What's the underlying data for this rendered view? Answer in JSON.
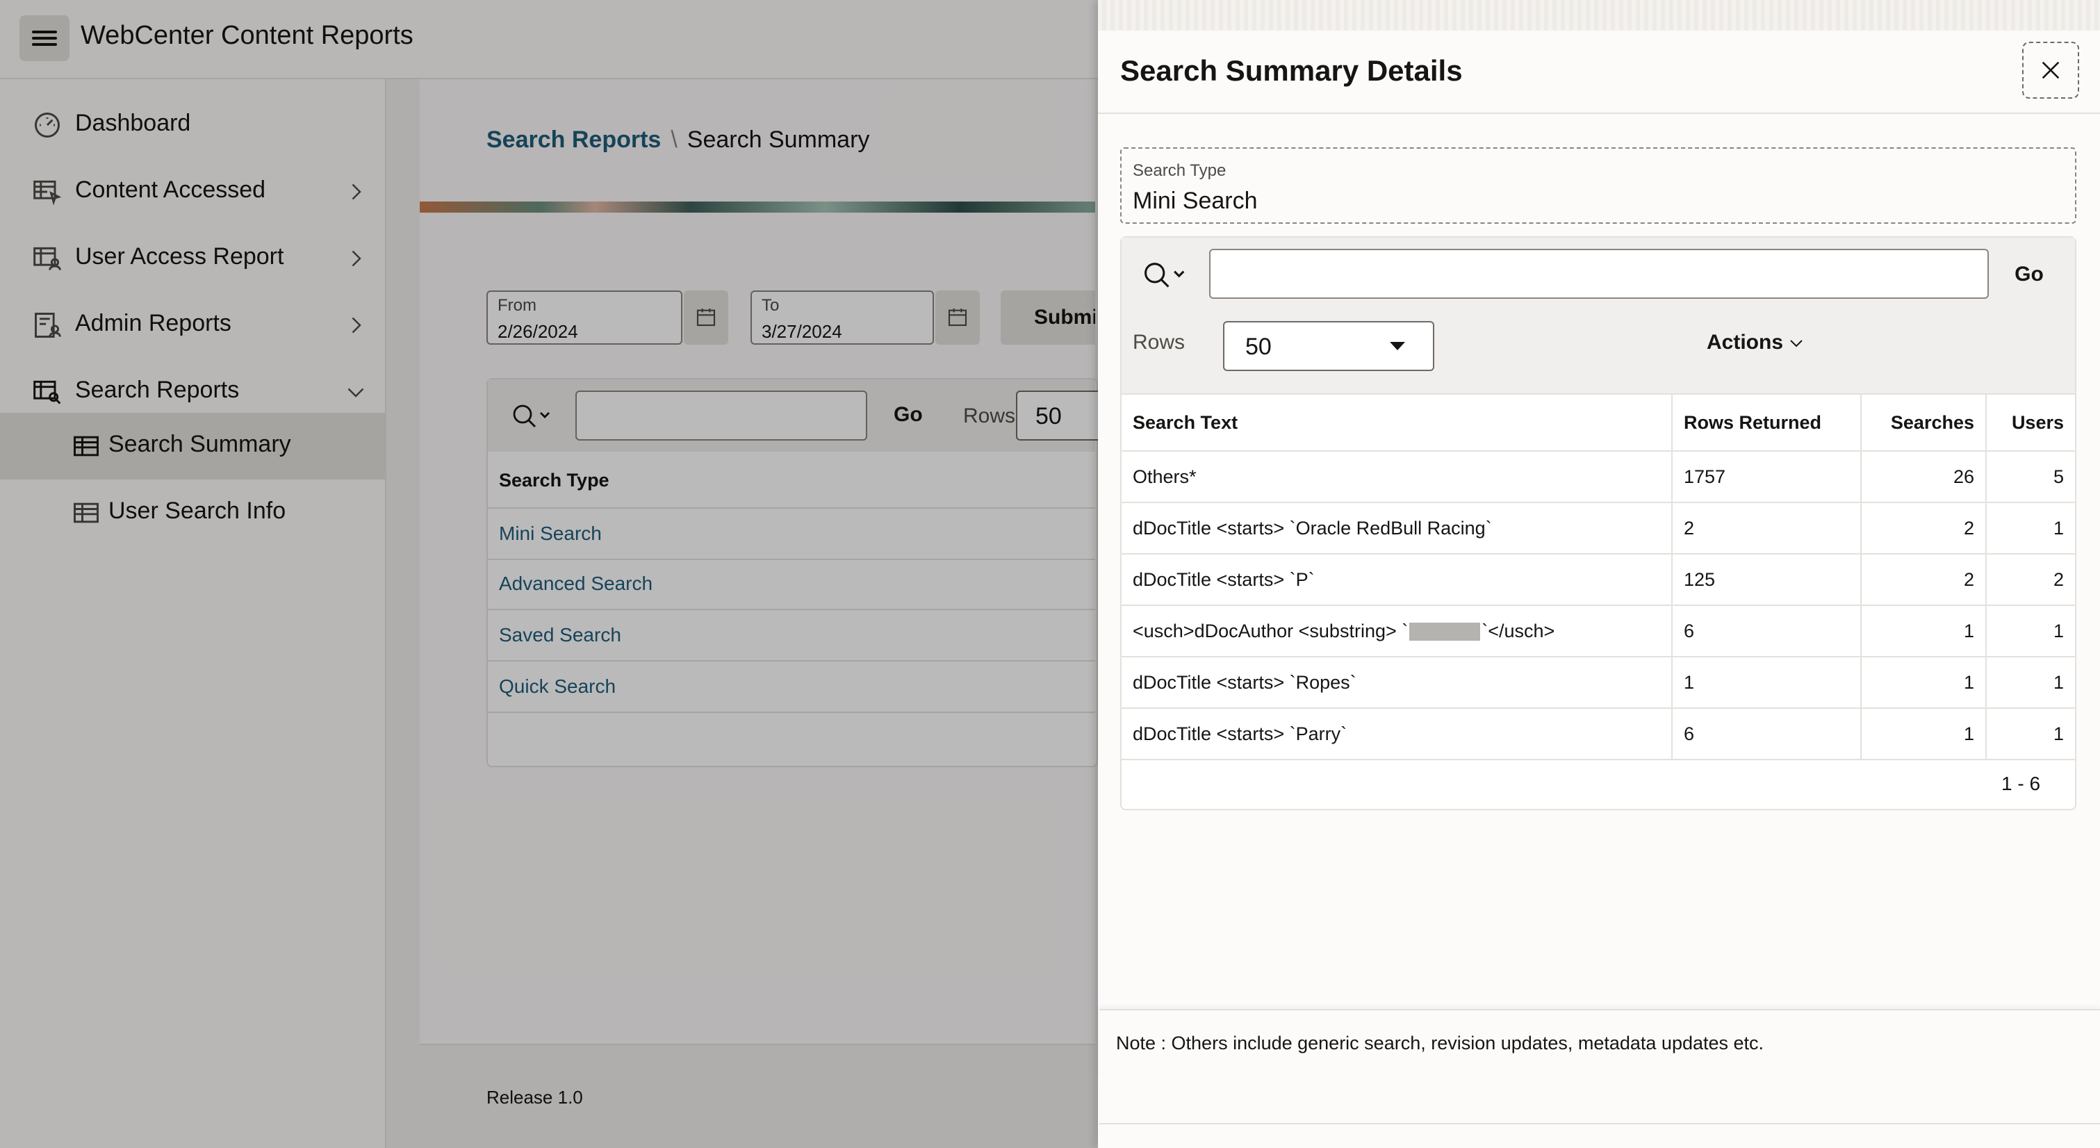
{
  "app": {
    "title": "WebCenter Content Reports"
  },
  "sidebar": {
    "items": [
      {
        "label": "Dashboard"
      },
      {
        "label": "Content Accessed"
      },
      {
        "label": "User Access Report"
      },
      {
        "label": "Admin Reports"
      },
      {
        "label": "Search Reports"
      },
      {
        "label": "Search Summary"
      },
      {
        "label": "User Search Info"
      }
    ]
  },
  "breadcrumb": {
    "parent": "Search Reports",
    "separator": "\\",
    "current": "Search Summary"
  },
  "filters": {
    "from_label": "From",
    "from_value": "2/26/2024",
    "to_label": "To",
    "to_value": "3/27/2024",
    "submit_label": "Submit"
  },
  "report": {
    "go_label": "Go",
    "rows_label": "Rows",
    "rows_value": "50",
    "column_header": "Search Type",
    "rows": [
      "Mini Search",
      "Advanced Search",
      "Saved Search",
      "Quick Search"
    ]
  },
  "footer": {
    "release": "Release 1.0"
  },
  "drawer": {
    "title": "Search Summary Details",
    "search_type_label": "Search Type",
    "search_type_value": "Mini Search",
    "go_label": "Go",
    "rows_label": "Rows",
    "rows_value": "50",
    "actions_label": "Actions",
    "columns": [
      "Search Text",
      "Rows Returned",
      "Searches",
      "Users"
    ],
    "rows": [
      {
        "text": "Others*",
        "rows_returned": "1757",
        "searches": "26",
        "users": "5"
      },
      {
        "text": "dDocTitle <starts> `Oracle RedBull Racing`",
        "rows_returned": "2",
        "searches": "2",
        "users": "1"
      },
      {
        "text": "dDocTitle <starts> `P`",
        "rows_returned": "125",
        "searches": "2",
        "users": "2"
      },
      {
        "text_prefix": "<usch>dDocAuthor <substring> `",
        "text_suffix": "`</usch>",
        "rows_returned": "6",
        "searches": "1",
        "users": "1"
      },
      {
        "text": "dDocTitle <starts> `Ropes`",
        "rows_returned": "1",
        "searches": "1",
        "users": "1"
      },
      {
        "text": "dDocTitle <starts> `Parry`",
        "rows_returned": "6",
        "searches": "1",
        "users": "1"
      }
    ],
    "pagination": "1 - 6",
    "note": "Note : Others include generic search, revision updates, metadata updates etc."
  }
}
